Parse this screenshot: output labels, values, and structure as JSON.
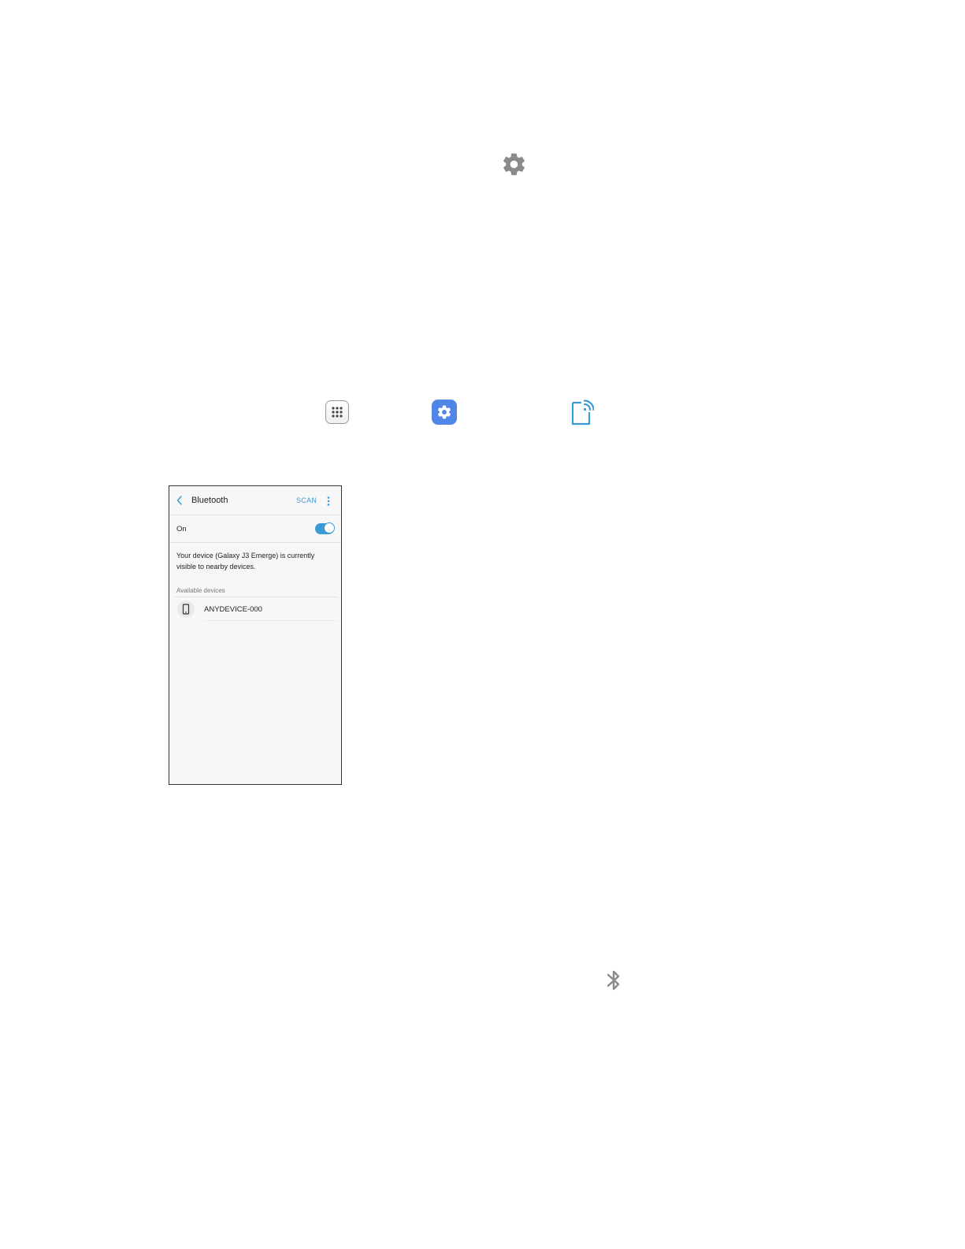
{
  "icons": {
    "top_icon": "gear-icon",
    "apps_icon": "apps-grid-icon",
    "settings_icon": "settings-app-icon",
    "connections_icon": "connections-icon",
    "bottom_icon": "bluetooth-icon"
  },
  "colors": {
    "settings_app": "#4f86e8",
    "accent": "#3b9bd6",
    "gear": "#8a8a8a"
  },
  "phone": {
    "header": {
      "title": "Bluetooth",
      "scan_label": "SCAN"
    },
    "toggle": {
      "label": "On",
      "state": "on"
    },
    "description": "Your device (Galaxy J3 Emerge) is currently visible to nearby devices.",
    "section_label": "Available devices",
    "devices": [
      {
        "name": "ANYDEVICE-000"
      }
    ]
  }
}
